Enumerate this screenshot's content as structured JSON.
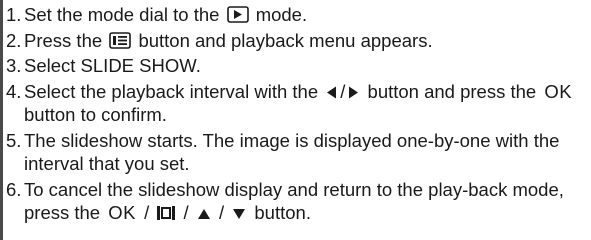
{
  "steps": [
    {
      "num": "1.",
      "a": "Set the mode dial to the",
      "b": "mode."
    },
    {
      "num": "2.",
      "a": "Press the",
      "b": "button and playback menu appears."
    },
    {
      "num": "3.",
      "a": "Select SLIDE SHOW."
    },
    {
      "num": "4.",
      "a": "Select the playback interval with the",
      "sep": "/",
      "b": "button and press the",
      "ok": "OK",
      "c": "button to confirm."
    },
    {
      "num": "5.",
      "a": "The slideshow starts. The image is displayed one-by-one with the interval that you set."
    },
    {
      "num": "6.",
      "a": "To cancel the slideshow display and return to the play-back mode, press the",
      "ok": "OK",
      "sep": "/",
      "b": "button."
    }
  ],
  "icons": [
    "playback-mode-icon",
    "menu-icon",
    "left-arrow-icon",
    "right-arrow-icon",
    "display-icon",
    "up-arrow-icon",
    "down-arrow-icon"
  ]
}
